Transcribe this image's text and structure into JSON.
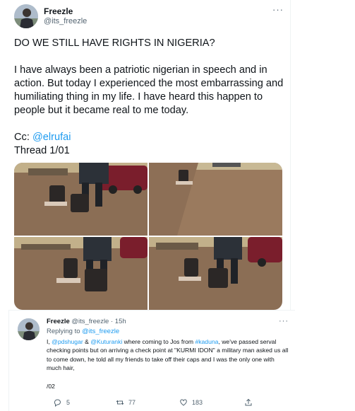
{
  "tweet": {
    "author_name": "Freezle",
    "author_handle": "@its_freezle",
    "more_icon": "more-dots-icon",
    "headline": "DO WE STILL HAVE RIGHTS IN NIGERIA?",
    "paragraph": "I have always been a patriotic nigerian in speech and in action. But today I experienced the most embarrassing and humiliating thing in my life. I have heard this happen to people but it became real to me today.",
    "cc_prefix": "Cc: ",
    "cc_mention": "@elrufai",
    "thread_label": "Thread 1/01",
    "photo_count": 4
  },
  "reply": {
    "author_name": "Freezle",
    "author_handle": "@its_freezle",
    "separator": "·",
    "time": "15h",
    "replying_prefix": "Replying to ",
    "replying_to": "@its_freezle",
    "body_part1": "I, ",
    "mention1": "@pdshugar",
    "body_part2": " & ",
    "mention2": "@Kuturanki",
    "body_part3": " where coming to Jos from ",
    "hashtag": "#kaduna",
    "body_part4": ", we've passed serval checking points but on arriving a check point at \"KURMI IDON\" a military man asked us all to come down, he told all my friends to take off their caps and I was the only one with much hair,",
    "signature": "/02",
    "reply_count": "5",
    "retweet_count": "77",
    "like_count": "183",
    "colors": {
      "link": "#1d9bf0",
      "muted": "#536471",
      "text": "#0f1419"
    }
  }
}
